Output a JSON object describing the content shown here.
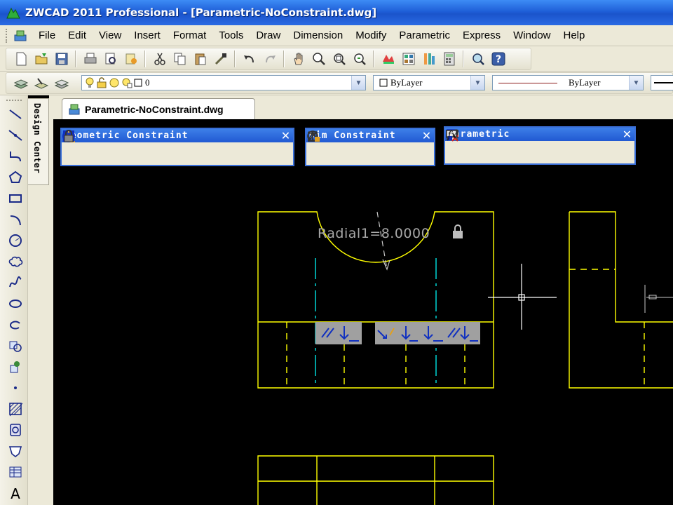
{
  "window": {
    "title": "ZWCAD 2011 Professional - [Parametric-NoConstraint.dwg]"
  },
  "menubar": {
    "items": [
      {
        "label": "File",
        "icon": "app-doc-icon"
      },
      {
        "label": "Edit"
      },
      {
        "label": "View"
      },
      {
        "label": "Insert"
      },
      {
        "label": "Format"
      },
      {
        "label": "Tools"
      },
      {
        "label": "Draw"
      },
      {
        "label": "Dimension"
      },
      {
        "label": "Modify"
      },
      {
        "label": "Parametric"
      },
      {
        "label": "Express"
      },
      {
        "label": "Window"
      },
      {
        "label": "Help"
      }
    ]
  },
  "standard_toolbar": {
    "icons": [
      "new-icon",
      "open-icon",
      "save-icon",
      "print-icon",
      "print-preview-icon",
      "publish-icon",
      "cut-icon",
      "copy-icon",
      "paste-icon",
      "match-properties-icon",
      "undo-icon",
      "redo-icon",
      "pan-icon",
      "zoom-realtime-icon",
      "zoom-window-icon",
      "zoom-previous-icon",
      "properties-icon",
      "design-center-icon",
      "tool-palettes-icon",
      "calculator-icon",
      "find-icon",
      "help-icon"
    ]
  },
  "layer_toolbar": {
    "layer_value": "0",
    "color_value": "ByLayer",
    "linetype_value": "ByLayer"
  },
  "design_center": {
    "label": "Design Center"
  },
  "document_tab": {
    "label": "Parametric-NoConstraint.dwg"
  },
  "left_toolbar": {
    "icons": [
      "line-icon",
      "construction-line-icon",
      "polyline-icon",
      "polygon-icon",
      "rectangle-icon",
      "arc-icon",
      "circle-icon",
      "revision-cloud-icon",
      "spline-icon",
      "ellipse-icon",
      "ellipse-arc-icon",
      "insert-block-icon",
      "make-block-icon",
      "point-icon",
      "hatch-icon",
      "region-icon",
      "table-icon",
      "multiline-text-icon"
    ]
  },
  "geometric_constraint_toolbar": {
    "title": "Geometric Constraint",
    "close": "✕"
  },
  "dim_constraint_toolbar": {
    "title": "Dim Constraint",
    "close": "✕"
  },
  "parametric_toolbar": {
    "title": "Parametric",
    "close": "✕"
  },
  "drawing": {
    "radial_label": "Radial1=8.0000",
    "colors": {
      "background": "#000000",
      "geometry": "#ffff00",
      "centerline": "#00c8c8",
      "constraint_bar": "#a0a0a0"
    }
  }
}
